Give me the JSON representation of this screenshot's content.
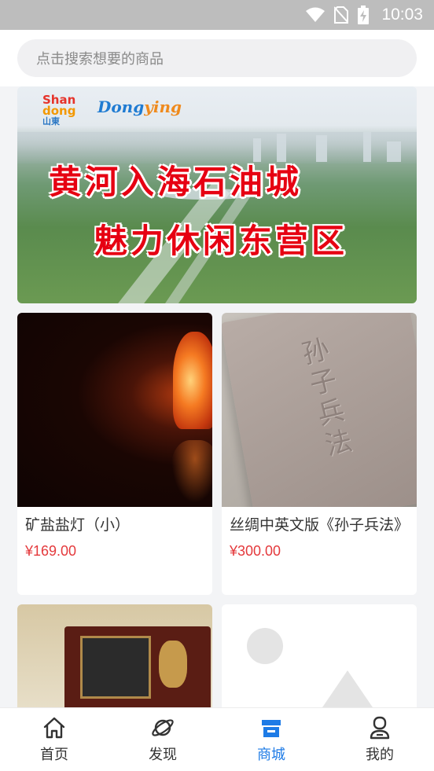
{
  "status_bar": {
    "time": "10:03",
    "icons": [
      "wifi-icon",
      "no-sim-icon",
      "battery-charging-icon"
    ]
  },
  "search": {
    "placeholder": "点击搜索想要的商品"
  },
  "banner": {
    "title_line1": "黄河入海石油城",
    "title_line2": "魅力休闲东营区",
    "logo_left": {
      "line1": "Shan",
      "line2": "dong",
      "line3": "山東"
    },
    "logo_right": {
      "text_a": "Dong",
      "text_b": "ying"
    }
  },
  "products": [
    {
      "name": "矿盐盐灯（小）",
      "price": "¥169.00",
      "image": "salt-lamp-image"
    },
    {
      "name": "丝绸中英文版《孙子兵法》",
      "price": "¥300.00",
      "image": "art-of-war-book-image",
      "image_text": "孙子兵法"
    },
    {
      "name": "",
      "price": "",
      "image": "bronze-chariot-box-image"
    },
    {
      "name": "",
      "price": "",
      "image": "image-placeholder"
    }
  ],
  "tabs": [
    {
      "label": "首页",
      "icon": "home-icon",
      "active": false
    },
    {
      "label": "发现",
      "icon": "planet-icon",
      "active": false
    },
    {
      "label": "商城",
      "icon": "store-icon",
      "active": true
    },
    {
      "label": "我的",
      "icon": "user-icon",
      "active": false
    }
  ],
  "colors": {
    "accent": "#1e7be6",
    "price": "#e4393c",
    "banner_title": "#e60012"
  }
}
